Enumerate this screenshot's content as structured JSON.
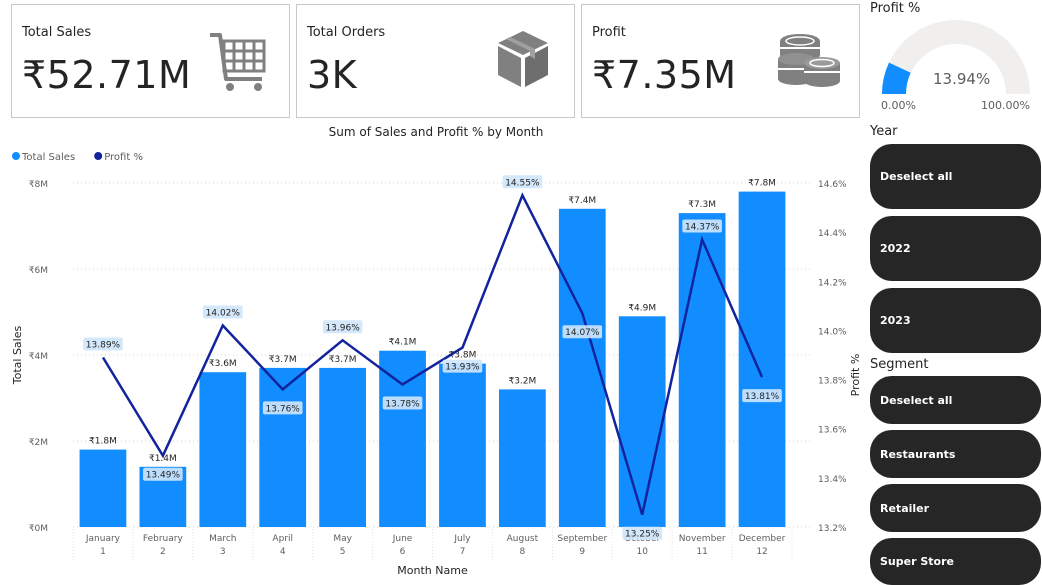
{
  "kpis": {
    "sales": {
      "label": "Total Sales",
      "value": "₹52.71M",
      "icon": "shopping-cart-icon"
    },
    "orders": {
      "label": "Total Orders",
      "value": "3K",
      "icon": "box-icon"
    },
    "profit": {
      "label": "Profit",
      "value": "₹7.35M",
      "icon": "coins-icon"
    }
  },
  "gauge": {
    "title": "Profit %",
    "value_label": "13.94%",
    "value": 13.94,
    "min_label": "0.00%",
    "max_label": "100.00%",
    "min": 0,
    "max": 100,
    "fill_color": "#118dff",
    "track_color": "#f0efee"
  },
  "slicers": {
    "year": {
      "title": "Year",
      "items": [
        "Deselect all",
        "2022",
        "2023"
      ]
    },
    "segment": {
      "title": "Segment",
      "items": [
        "Deselect all",
        "Restaurants",
        "Retailer",
        "Super Store"
      ]
    }
  },
  "chart_data": {
    "type": "bar",
    "title": "Sum of Sales and Profit % by Month",
    "xlabel": "Month Name",
    "ylabel": "Total Sales",
    "y2label": "Profit %",
    "legend": [
      {
        "name": "Total Sales",
        "color": "#118dff"
      },
      {
        "name": "Profit %",
        "color": "#12239e"
      }
    ],
    "categories": [
      "January",
      "February",
      "March",
      "April",
      "May",
      "June",
      "July",
      "August",
      "September",
      "October",
      "November",
      "December"
    ],
    "category_numbers": [
      "1",
      "2",
      "3",
      "4",
      "5",
      "6",
      "7",
      "8",
      "9",
      "10",
      "11",
      "12"
    ],
    "series": [
      {
        "name": "Total Sales",
        "type": "bar",
        "axis": "left",
        "color": "#118dff",
        "values": [
          1.8,
          1.4,
          3.6,
          3.7,
          3.7,
          4.1,
          3.8,
          3.2,
          7.4,
          4.9,
          7.3,
          7.8
        ],
        "labels": [
          "₹1.8M",
          "₹1.4M",
          "₹3.6M",
          "₹3.7M",
          "₹3.7M",
          "₹4.1M",
          "₹3.8M",
          "₹3.2M",
          "₹7.4M",
          "₹4.9M",
          "₹7.3M",
          "₹7.8M"
        ]
      },
      {
        "name": "Profit %",
        "type": "line",
        "axis": "right",
        "color": "#12239e",
        "values": [
          13.89,
          13.49,
          14.02,
          13.76,
          13.96,
          13.78,
          13.93,
          14.55,
          14.07,
          13.25,
          14.37,
          13.81
        ],
        "labels": [
          "13.89%",
          "13.49%",
          "14.02%",
          "13.76%",
          "13.96%",
          "13.78%",
          "13.93%",
          "14.55%",
          "14.07%",
          "13.25%",
          "14.37%",
          "13.81%"
        ]
      }
    ],
    "ylim": [
      0,
      8
    ],
    "yticks": [
      0,
      2,
      4,
      6,
      8
    ],
    "ytick_labels": [
      "₹0M",
      "₹2M",
      "₹4M",
      "₹6M",
      "₹8M"
    ],
    "y2lim": [
      13.2,
      14.6
    ],
    "y2ticks": [
      13.2,
      13.4,
      13.6,
      13.8,
      14.0,
      14.2,
      14.4,
      14.6
    ],
    "y2tick_labels": [
      "13.2%",
      "13.4%",
      "13.6%",
      "13.8%",
      "14.0%",
      "14.2%",
      "14.4%",
      "14.6%"
    ],
    "grid": true,
    "legend_position": "top-left"
  }
}
